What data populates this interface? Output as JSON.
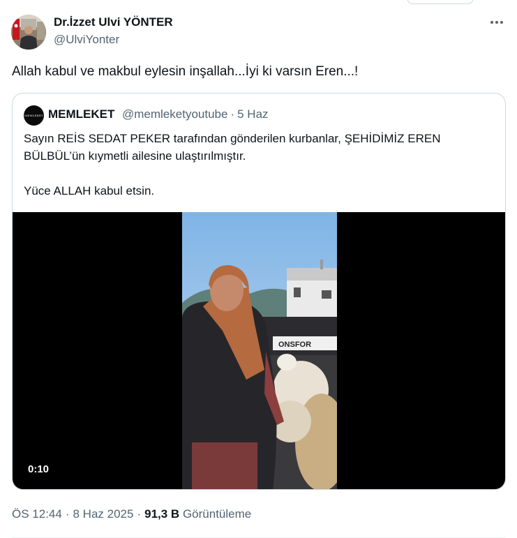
{
  "tweet": {
    "author_name": "Dr.İzzet Ulvi YÖNTER",
    "author_handle": "@UlviYonter",
    "text": "Allah kabul ve makbul eylesin inşallah...İyi ki varsın Eren...!",
    "more_icon": "more-horizontal-icon"
  },
  "quote": {
    "avatar_text": "MEMLEKET",
    "name": "MEMLEKET",
    "handle": "@memleketyoutube",
    "separator": "·",
    "date": "5 Haz",
    "line1": "Sayın REİS SEDAT PEKER tarafından gönderilen kurbanlar, ŞEHİDİMİZ EREN BÜLBÜL’ün kıymetli ailesine ulaştırılmıştır.",
    "line2": "Yüce ALLAH kabul etsin.",
    "video": {
      "duration": "0:10",
      "truck_text": "ONSFOR"
    }
  },
  "meta": {
    "time": "ÖS 12:44",
    "separator": "·",
    "date": "8 Haz 2025",
    "views_count": "91,3 B",
    "views_label": "Görüntüleme"
  },
  "colors": {
    "text_primary": "#0f1419",
    "text_secondary": "#536471",
    "border": "#cfd9de"
  }
}
